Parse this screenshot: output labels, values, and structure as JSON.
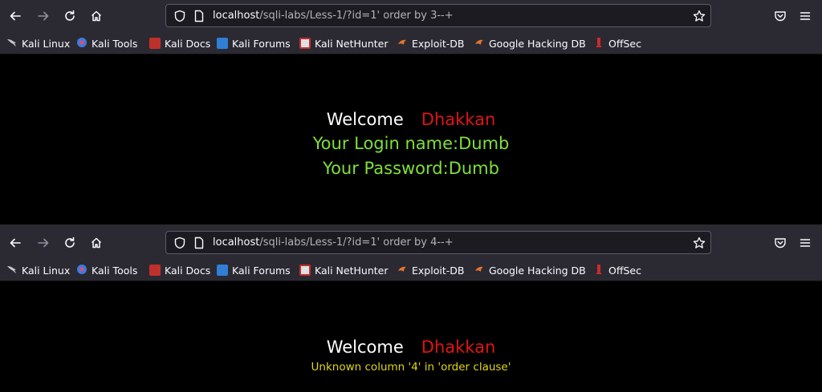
{
  "screens": [
    {
      "url_host": "localhost",
      "url_path": "/sqli-labs/Less-1/?id=1' order by 3--+",
      "bookmarks": [
        "Kali Linux",
        "Kali Tools",
        "Kali Docs",
        "Kali Forums",
        "Kali NetHunter",
        "Exploit-DB",
        "Google Hacking DB",
        "OffSec"
      ],
      "welcome": "Welcome",
      "name": "Dhakkan",
      "login_line": "Your Login name:Dumb",
      "password_line": "Your Password:Dumb"
    },
    {
      "url_host": "localhost",
      "url_path": "/sqli-labs/Less-1/?id=1' order by 4--+",
      "bookmarks": [
        "Kali Linux",
        "Kali Tools",
        "Kali Docs",
        "Kali Forums",
        "Kali NetHunter",
        "Exploit-DB",
        "Google Hacking DB",
        "OffSec"
      ],
      "welcome": "Welcome",
      "name": "Dhakkan",
      "error_line": "Unknown column '4' in 'order clause'"
    }
  ],
  "colors": {
    "toolbar_bg": "#2b2a33",
    "page_bg": "#000000",
    "welcome_name": "#e01414",
    "login_text": "#7ee03b",
    "error_text": "#e0d616"
  },
  "icons": [
    "back-arrow-icon",
    "forward-arrow-icon",
    "reload-icon",
    "home-icon",
    "shield-icon",
    "page-icon",
    "star-icon",
    "pocket-icon",
    "menu-icon"
  ]
}
